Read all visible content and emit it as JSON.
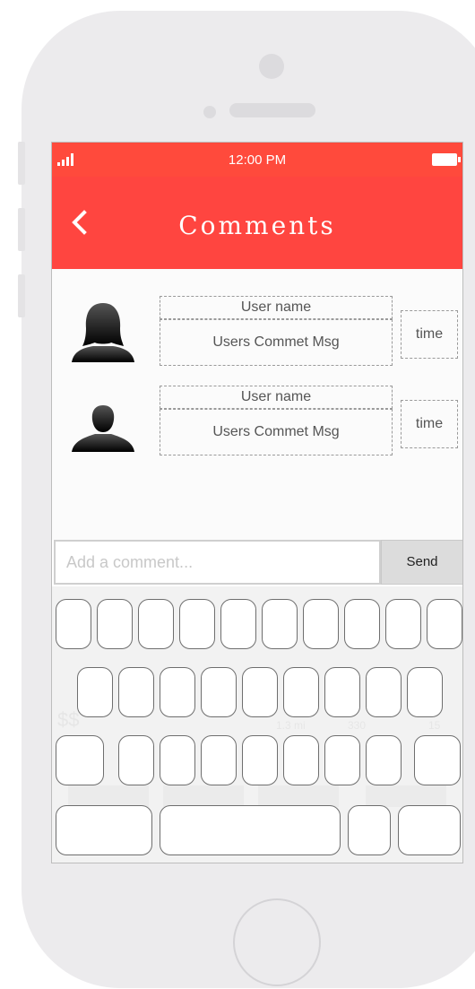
{
  "status_bar": {
    "time": "12:00 PM"
  },
  "nav": {
    "back_icon": "chevron-left-icon",
    "title": "Comments"
  },
  "comments": [
    {
      "user_name": "User name",
      "message": "Users Commet Msg",
      "time": "time",
      "avatar": "female-avatar-icon"
    },
    {
      "user_name": "User name",
      "message": "Users Commet Msg",
      "time": "time",
      "avatar": "male-avatar-icon"
    }
  ],
  "comment_input": {
    "placeholder": "Add a comment..."
  },
  "send_button": {
    "label": "Send"
  },
  "keyboard_background": {
    "price": "$$",
    "stats": [
      "1.3 mi",
      "330",
      "15"
    ]
  },
  "colors": {
    "status_bar": "#ff4a3c",
    "nav_bar": "#ff4540",
    "send_bg": "#dcdcdc"
  }
}
